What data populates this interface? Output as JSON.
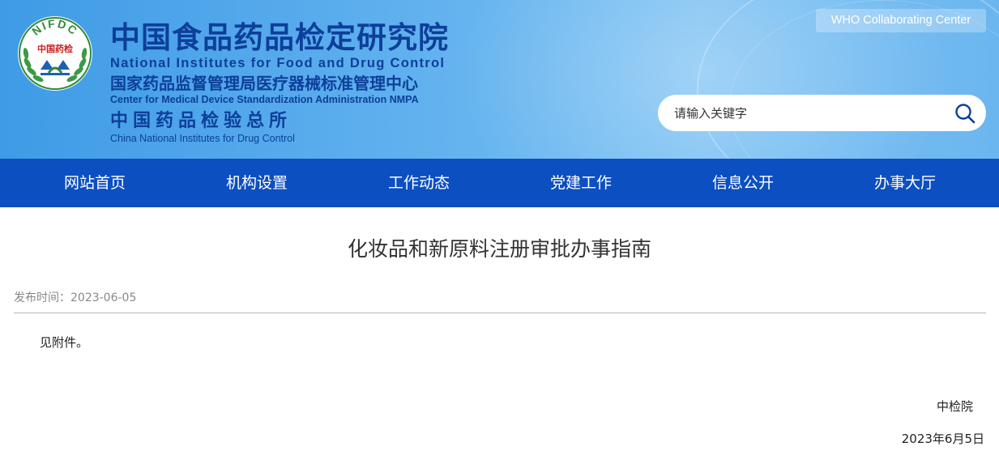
{
  "header": {
    "logo_text": "NIFDC",
    "logo_inner_text": "中国药检",
    "org_name_cn": "中国食品药品检定研究院",
    "org_name_en": "National Institutes for Food and Drug Control",
    "center_name_cn": "国家药品监督管理局医疗器械标准管理中心",
    "center_name_en": "Center for Medical Device Standardization Administration NMPA",
    "institute_name_cn": "中国药品检验总所",
    "institute_name_en": "China National Institutes for Drug Control",
    "who_link": "WHO Collaborating Center",
    "search": {
      "placeholder": "请输入关键字",
      "icon": "search-icon"
    }
  },
  "nav": {
    "items": [
      {
        "label": "网站首页"
      },
      {
        "label": "机构设置"
      },
      {
        "label": "工作动态"
      },
      {
        "label": "党建工作"
      },
      {
        "label": "信息公开"
      },
      {
        "label": "办事大厅"
      }
    ]
  },
  "article": {
    "title": "化妆品和新原料注册审批办事指南",
    "publish_label": "发布时间：",
    "publish_date": "2023-06-05",
    "body": "见附件。",
    "signature_org": "中检院",
    "signature_date": "2023年6月5日"
  },
  "colors": {
    "banner_blue": "#4aa3ea",
    "title_navy": "#0d3f9a",
    "nav_blue": "#0c4fc0",
    "logo_green": "#2f8a3a",
    "logo_red": "#c8201e"
  }
}
